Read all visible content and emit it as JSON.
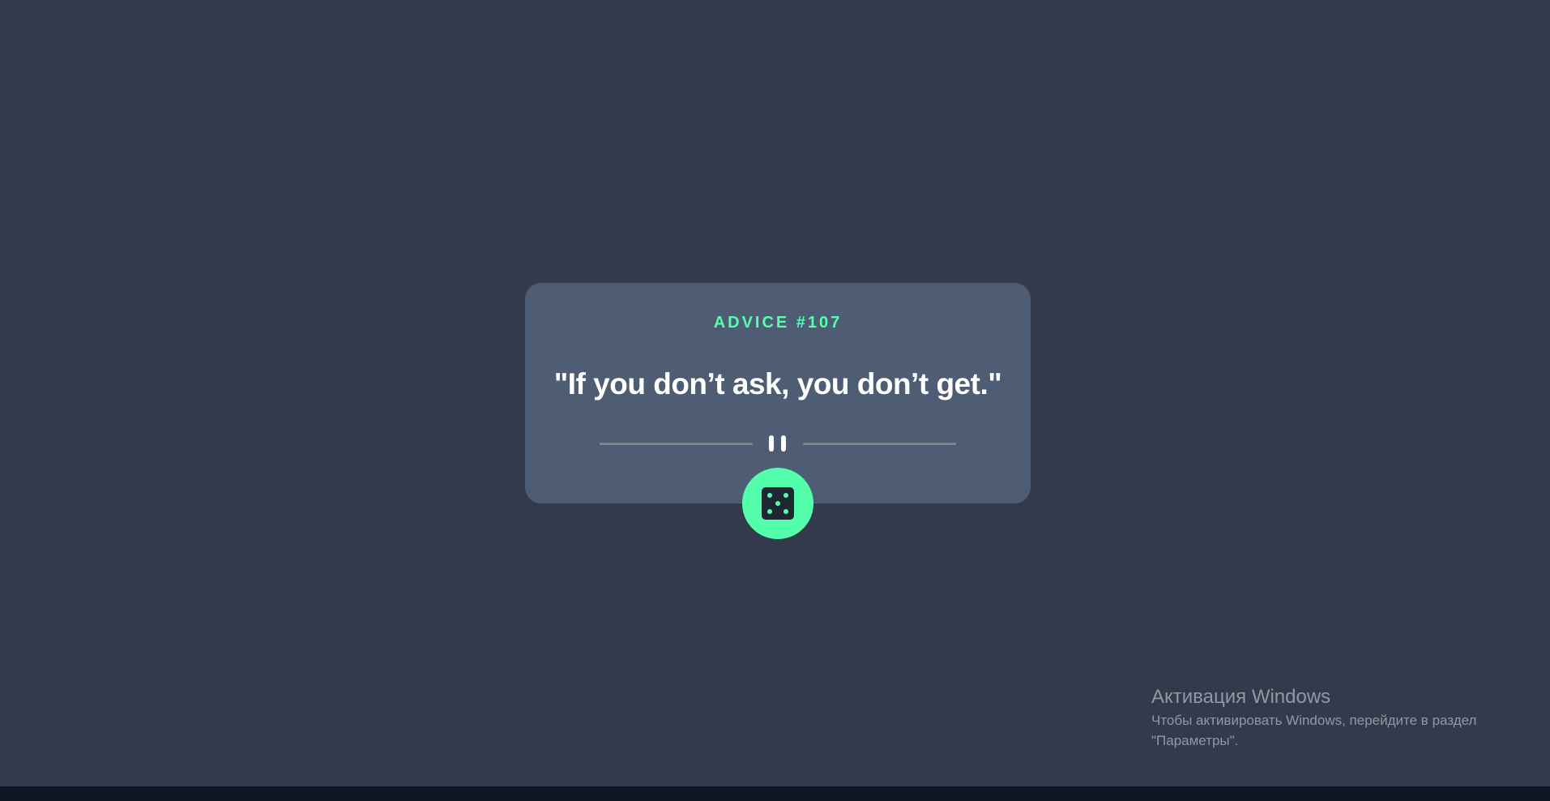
{
  "card": {
    "advice_number": "ADVICE #107",
    "advice_text": "\"If you don’t ask, you don’t get.\""
  },
  "dice_button": {
    "icon": "dice-icon"
  },
  "windows_activation": {
    "title": "Активация Windows",
    "line1": "Чтобы активировать Windows, перейдите в раздел",
    "line2": "\"Параметры\"."
  },
  "colors": {
    "background": "#323a4b",
    "card": "#4f5d74",
    "accent": "#53ffaa",
    "text": "#ffffff",
    "divider": "#7d8691"
  }
}
